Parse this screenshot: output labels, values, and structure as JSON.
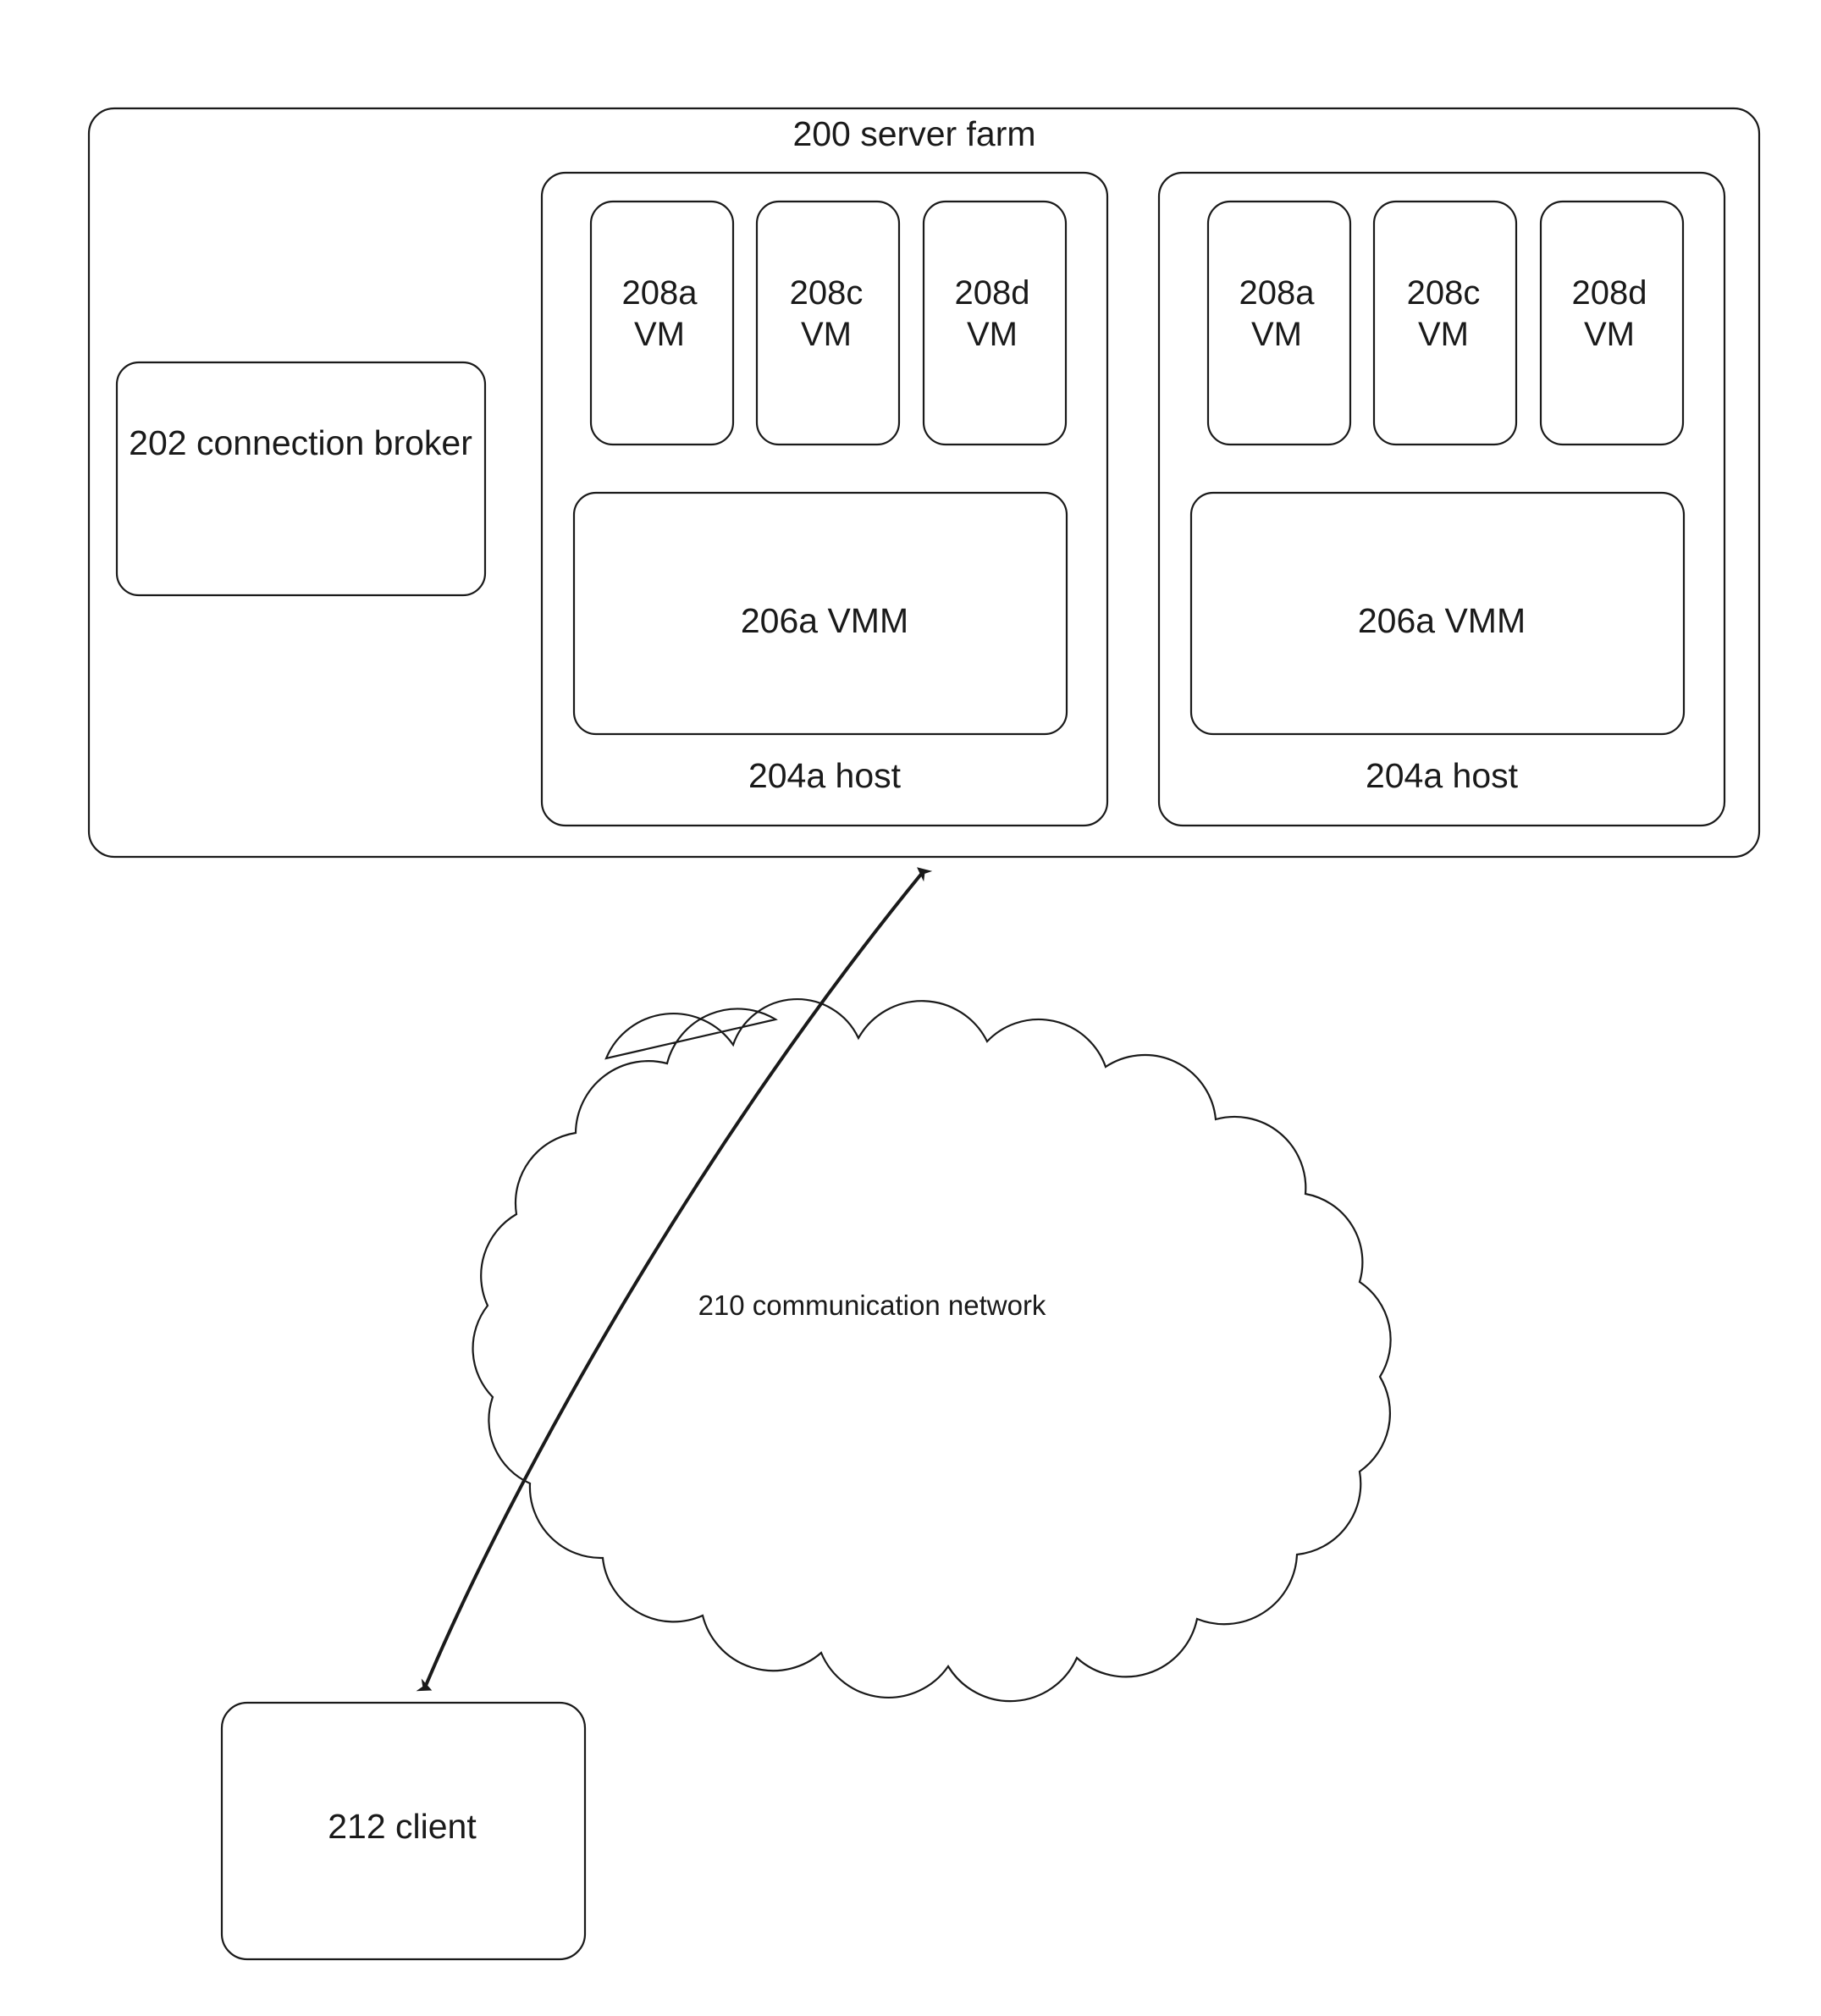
{
  "diagram": {
    "title": "200 server farm",
    "server_farm": {
      "label": "200 server farm",
      "connection_broker": {
        "label": "202 connection broker"
      },
      "hosts": [
        {
          "label": "204a host",
          "vmm": {
            "label": "206a VMM"
          },
          "vms": [
            {
              "id": "208a",
              "type": "VM",
              "label": "208a\nVM"
            },
            {
              "id": "208c",
              "type": "VM",
              "label": "208c\nVM"
            },
            {
              "id": "208d",
              "type": "VM",
              "label": "208d\nVM"
            }
          ]
        },
        {
          "label": "204a host",
          "vmm": {
            "label": "206a VMM"
          },
          "vms": [
            {
              "id": "208a",
              "type": "VM",
              "label": "208a\nVM"
            },
            {
              "id": "208c",
              "type": "VM",
              "label": "208c\nVM"
            },
            {
              "id": "208d",
              "type": "VM",
              "label": "208d\nVM"
            }
          ]
        }
      ]
    },
    "network": {
      "label": "210 communication network",
      "shape": "cloud"
    },
    "client": {
      "label": "212 client"
    },
    "connector": {
      "kind": "double-headed-curved-arrow",
      "from": "212 client",
      "to": "200 server farm"
    },
    "colors": {
      "stroke": "#1a1a1a",
      "text": "#1a1a1a",
      "background": "#ffffff"
    }
  }
}
